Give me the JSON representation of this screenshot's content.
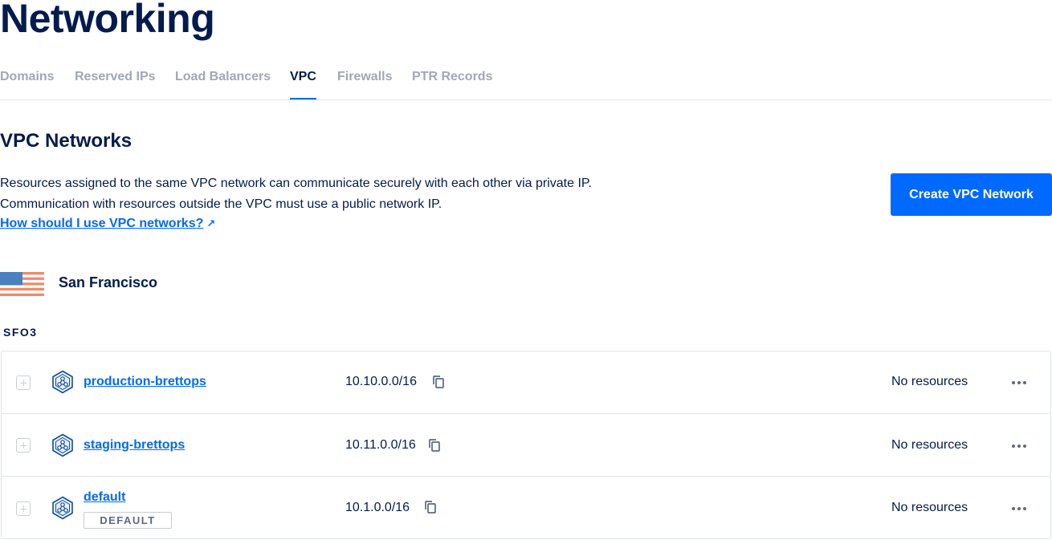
{
  "page": {
    "title": "Networking"
  },
  "tabs": [
    {
      "label": "Domains",
      "active": false
    },
    {
      "label": "Reserved IPs",
      "active": false
    },
    {
      "label": "Load Balancers",
      "active": false
    },
    {
      "label": "VPC",
      "active": true
    },
    {
      "label": "Firewalls",
      "active": false
    },
    {
      "label": "PTR Records",
      "active": false
    }
  ],
  "section": {
    "title": "VPC Networks",
    "description_line1": "Resources assigned to the same VPC network can communicate securely with each other via private IP.",
    "description_line2": "Communication with resources outside the VPC must use a public network IP.",
    "help_link": "How should I use VPC networks?",
    "create_button": "Create VPC Network"
  },
  "region": {
    "name": "San Francisco",
    "flag_icon": "us-flag-icon",
    "datacenter": "SFO3"
  },
  "vpcs": [
    {
      "name": "production-brettops",
      "ip_range": "10.10.0.0/16",
      "resources": "No resources",
      "badge": ""
    },
    {
      "name": "staging-brettops",
      "ip_range": "10.11.0.0/16",
      "resources": "No resources",
      "badge": ""
    },
    {
      "name": "default",
      "ip_range": "10.1.0.0/16",
      "resources": "No resources",
      "badge": "DEFAULT"
    }
  ],
  "colors": {
    "primary": "#0069ff",
    "text": "#031b4e",
    "muted": "#a0a8b5",
    "border": "#dfe3e8"
  }
}
